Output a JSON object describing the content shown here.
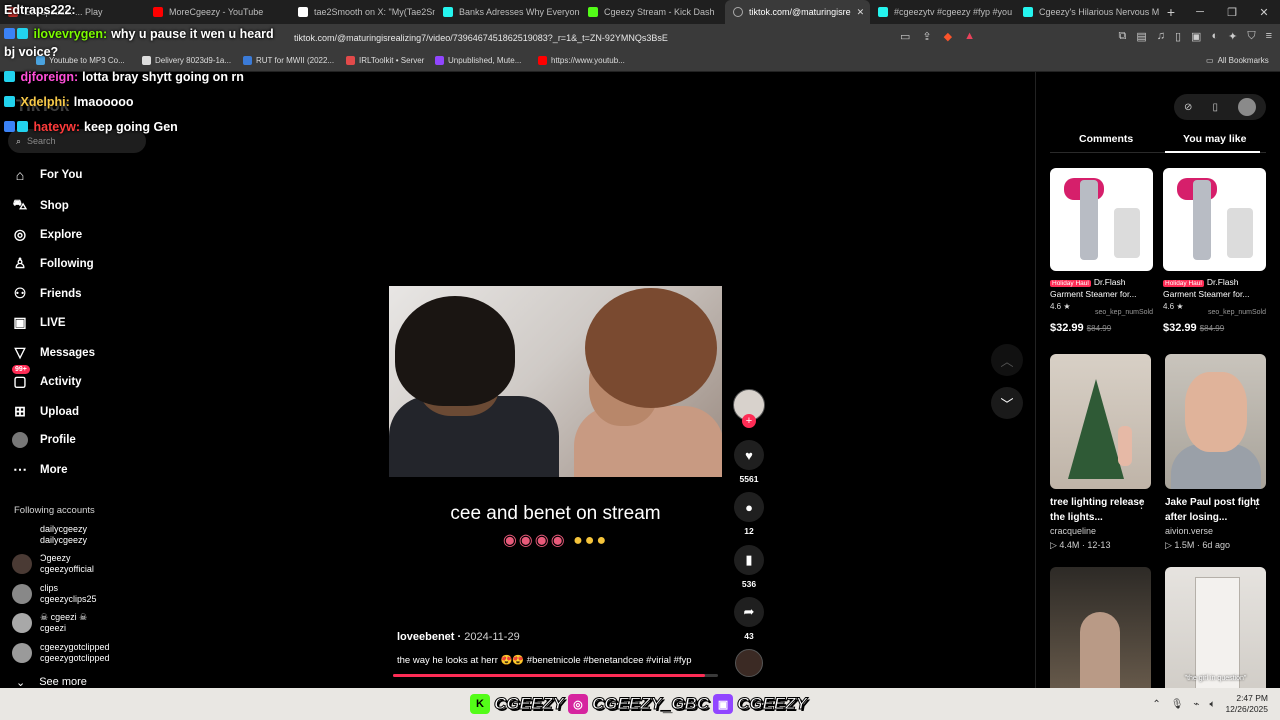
{
  "browser": {
    "tabs": [
      {
        "title": "Edtraps222: ... Play",
        "color": "#c4302b",
        "active": false
      },
      {
        "title": "MoreCgeezy - YouTube",
        "color": "#ff0000",
        "active": false
      },
      {
        "title": "tae2Smooth on X: \"My(Tae2Sm",
        "color": "#ffffff",
        "active": false
      },
      {
        "title": "Banks Adresses Why Everyone",
        "color": "#25f4ee",
        "active": false
      },
      {
        "title": "Cgeezy Stream - Kick Dash",
        "color": "#53fc18",
        "active": false
      },
      {
        "title": "tiktok.com/@maturingisre",
        "color": "#25f4ee",
        "active": true
      },
      {
        "title": "#cgeezytv #cgeezy #fyp #you",
        "color": "#25f4ee",
        "active": false
      },
      {
        "title": "Cgeezy's Hilarious Nervous M",
        "color": "#25f4ee",
        "active": false
      }
    ],
    "url": "tiktok.com/@maturingisrealizing7/video/7396467451862519083?_r=1&_t=ZN-92YMNQs3BsE",
    "bookmarks": [
      {
        "label": "Youtube to MP3 Co...",
        "color": "#4aa3df"
      },
      {
        "label": "Delivery 8023d9-1a...",
        "color": "#dddddd"
      },
      {
        "label": "RUT for MWII (2022...",
        "color": "#3b7bd8"
      },
      {
        "label": "IRLToolkit • Server",
        "color": "#e24a4a"
      },
      {
        "label": "Unpublished, Mute...",
        "color": "#9146ff"
      },
      {
        "label": "https://www.youtub...",
        "color": "#ff0000"
      }
    ],
    "all_bookmarks": "All Bookmarks"
  },
  "chat": [
    {
      "user": "ilovevrygen:",
      "message": "why u pause it wen u heard",
      "user_color": "#7cfc00"
    },
    {
      "user": "djforeign:",
      "message": "lotta bray shytt going on rn",
      "user_color": "#ff4fd8"
    },
    {
      "user": "Xdelphi:",
      "message": "lmaooooo",
      "user_color": "#f7c948"
    },
    {
      "user": "hateyw:",
      "message": "keep going Gen",
      "user_color": "#ff3b3b"
    }
  ],
  "chat_continuation": "bj voice?",
  "chat_header": "Edtraps222:",
  "tiktok": {
    "logo": "TikTok",
    "search_placeholder": "Search",
    "nav": [
      {
        "label": "For You",
        "icon": "home-icon"
      },
      {
        "label": "Shop",
        "icon": "shop-icon"
      },
      {
        "label": "Explore",
        "icon": "compass-icon"
      },
      {
        "label": "Following",
        "icon": "following-icon"
      },
      {
        "label": "Friends",
        "icon": "friends-icon"
      },
      {
        "label": "LIVE",
        "icon": "live-icon"
      },
      {
        "label": "Messages",
        "icon": "messages-icon"
      },
      {
        "label": "Activity",
        "icon": "activity-icon",
        "badge": "99+"
      },
      {
        "label": "Upload",
        "icon": "upload-icon"
      },
      {
        "label": "Profile",
        "icon": "profile-icon"
      },
      {
        "label": "More",
        "icon": "more-icon"
      }
    ],
    "following_title": "Following accounts",
    "following": [
      {
        "name": "dailycgeezy",
        "handle": "dailycgeezy"
      },
      {
        "name": "Ɔgeezy",
        "handle": "cgeezyofficial"
      },
      {
        "name": "clips",
        "handle": "cgeezyclips25"
      },
      {
        "name": "☠ cgeezi ☠",
        "handle": "cgeezi"
      },
      {
        "name": "cgeezygotclipped",
        "handle": "cgeezygotclipped"
      }
    ],
    "see_more": "See more"
  },
  "video": {
    "caption": "cee and benet on stream",
    "author": "loveebenet",
    "date": "2024-11-29",
    "description": "the way he looks at herr 😍😍 #benetnicole #benetandcee #virial #fyp",
    "progress": 0.96,
    "likes": "5561",
    "comments": "12",
    "saves": "536",
    "shares": "43"
  },
  "right_panel": {
    "tabs": [
      "Comments",
      "You may like"
    ],
    "active_tab": "You may like",
    "products": [
      {
        "badge": "Holiday Haul",
        "title": "Dr.Flash Garment Steamer for...",
        "rating": "4.6 ★",
        "sold": "seo_kep_numSold",
        "price": "$32.99",
        "old_price": "$84.99"
      },
      {
        "badge": "Holiday Haul",
        "title": "Dr.Flash Garment Steamer for...",
        "rating": "4.6 ★",
        "sold": "seo_kep_numSold",
        "price": "$32.99",
        "old_price": "$84.99"
      }
    ],
    "videos": [
      {
        "title": "tree lighting release the lights...",
        "author": "cracqueline",
        "meta": "▷ 4.4M · 12-13"
      },
      {
        "title": "Jake Paul post fight after losing...",
        "author": "aivion.verse",
        "meta": "▷ 1.5M · 6d ago"
      },
      {
        "title": "",
        "author": "",
        "meta": "",
        "overlay": ""
      },
      {
        "title": "",
        "author": "",
        "meta": "",
        "overlay": "\"the girl in question\""
      }
    ]
  },
  "overlay_socials": [
    "CGEEZY",
    "CGEEZY_GBC",
    "CGEEZY"
  ],
  "clock": {
    "time": "2:47 PM",
    "date": "12/26/2025"
  }
}
